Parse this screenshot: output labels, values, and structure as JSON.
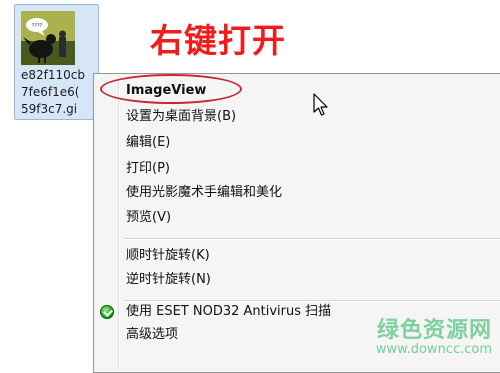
{
  "annotation": {
    "text": "右键打开",
    "color": "#f21b1b"
  },
  "file": {
    "name_lines": [
      "e82f110cb",
      "7fe6f1e6(",
      "59f3c7.gi"
    ],
    "thumb_bubble_text": "????"
  },
  "context_menu": {
    "items": [
      {
        "label": "ImageView",
        "default": true
      },
      {
        "label": "设置为桌面背景(B)"
      },
      {
        "label": "编辑(E)"
      },
      {
        "label": "打印(P)"
      },
      {
        "label": "使用光影魔术手编辑和美化"
      },
      {
        "label": "预览(V)"
      },
      {
        "label": "顺时针旋转(K)"
      },
      {
        "label": "逆时针旋转(N)"
      },
      {
        "label": "使用 ESET NOD32 Antivirus 扫描",
        "icon": "eset-antivirus-icon"
      },
      {
        "label": "高级选项"
      }
    ]
  },
  "watermark": {
    "text": "绿色资源网",
    "url": "www.downcc.com",
    "color": "#1db35a"
  },
  "colors": {
    "highlight": "#c8282e",
    "selection": "#d6e6f7"
  }
}
